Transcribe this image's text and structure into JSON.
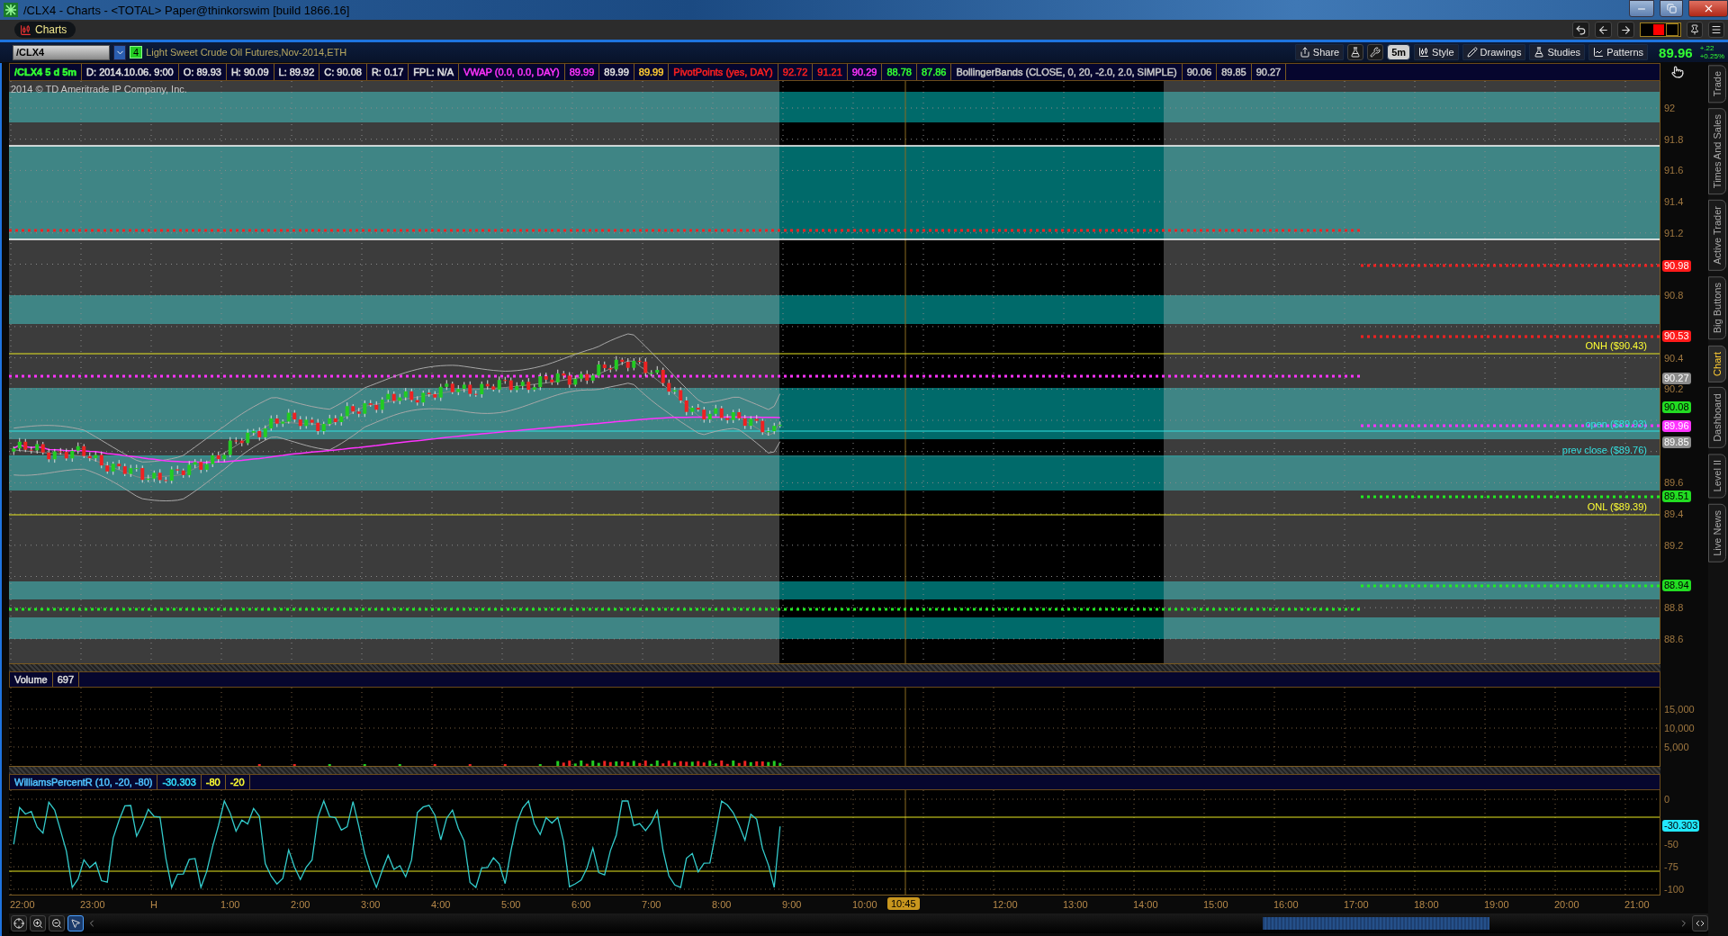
{
  "window": {
    "title": "/CLX4 - Charts - <TOTAL> Paper@thinkorswim [build 1866.16]"
  },
  "app_bar": {
    "tab": "Charts"
  },
  "symbol_bar": {
    "symbol": "/CLX4",
    "badge": "4",
    "description": "Light Sweet Crude Oil Futures,Nov-2014,ETH",
    "tools": [
      {
        "kind": "button",
        "label": "Share"
      },
      {
        "kind": "icon"
      },
      {
        "kind": "icon"
      },
      {
        "kind": "interval",
        "label": "5m"
      },
      {
        "kind": "button",
        "label": "Style"
      },
      {
        "kind": "button",
        "label": "Drawings"
      },
      {
        "kind": "button",
        "label": "Studies"
      },
      {
        "kind": "button",
        "label": "Patterns"
      }
    ],
    "last": "89.96",
    "change": "+.22",
    "change_pct": "+0.25%"
  },
  "study_header": [
    {
      "text": "/CLX4 5 d 5m",
      "color": "#33ff33"
    },
    {
      "text": "D: 2014.10.06. 9:00",
      "color": "#e0e0e0"
    },
    {
      "text": "O: 89.93",
      "color": "#e0e0e0"
    },
    {
      "text": "H: 90.09",
      "color": "#e0e0e0"
    },
    {
      "text": "L: 89.92",
      "color": "#e0e0e0"
    },
    {
      "text": "C: 90.08",
      "color": "#e0e0e0"
    },
    {
      "text": "R: 0.17",
      "color": "#e0e0e0"
    },
    {
      "text": "FPL: N/A",
      "color": "#e0e0e0"
    },
    {
      "text": "VWAP (0.0, 0.0, DAY)",
      "color": "#ff33ff"
    },
    {
      "text": "89.99",
      "color": "#ff33ff"
    },
    {
      "text": "89.99",
      "color": "#e0e0e0"
    },
    {
      "text": "89.99",
      "color": "#ffcc33"
    },
    {
      "text": "PivotPoints (yes, DAY)",
      "color": "#ff2020"
    },
    {
      "text": "92.72",
      "color": "#ff2020"
    },
    {
      "text": "91.21",
      "color": "#ff2020"
    },
    {
      "text": "90.29",
      "color": "#ff33ff"
    },
    {
      "text": "88.78",
      "color": "#33ff33"
    },
    {
      "text": "87.86",
      "color": "#33ff33"
    },
    {
      "text": "BollingerBands (CLOSE, 0, 20, -2.0, 2.0, SIMPLE)",
      "color": "#c8c8c8"
    },
    {
      "text": "90.06",
      "color": "#c8c8c8"
    },
    {
      "text": "89.85",
      "color": "#c8c8c8"
    },
    {
      "text": "90.27",
      "color": "#c8c8c8"
    }
  ],
  "price_chart": {
    "watermark": "2014 © TD Ameritrade IP Company, Inc.",
    "price_ticks": [
      "92",
      "91.8",
      "91.6",
      "91.4",
      "91.2",
      "90.8",
      "90.4",
      "90.2",
      "89.6",
      "89.4",
      "89.2",
      "88.8",
      "88.6"
    ],
    "level_tags": [
      {
        "text": "90.98",
        "color": "#ff1a1a"
      },
      {
        "text": "90.53",
        "color": "#ff1a1a"
      },
      {
        "text": "90.27",
        "color": "#8c8c8c"
      },
      {
        "text": "90.08",
        "color": "#22dd22"
      },
      {
        "text": "89.96",
        "color": "#ff33ff"
      },
      {
        "text": "89.85",
        "color": "#8c8c8c"
      },
      {
        "text": "89.51",
        "color": "#22dd22"
      },
      {
        "text": "88.94",
        "color": "#22dd22"
      }
    ],
    "line_labels": [
      {
        "text": "ONH ($90.43)",
        "color": "#ffff33"
      },
      {
        "text": "open ($89.93)",
        "color": "#33e0e0"
      },
      {
        "text": "prev close ($89.76)",
        "color": "#33e0e0"
      },
      {
        "text": "ONL ($89.39)",
        "color": "#ffff33"
      }
    ]
  },
  "volume": {
    "title": "Volume",
    "value": "697",
    "ticks": [
      "15,000",
      "10,000",
      "5,000"
    ]
  },
  "williams": {
    "cells": [
      {
        "text": "WilliamsPercentR (10, -20, -80)",
        "color": "#4fc3ff"
      },
      {
        "text": "-30.303",
        "color": "#33e0ff"
      },
      {
        "text": "-80",
        "color": "#ffff33"
      },
      {
        "text": "-20",
        "color": "#ffff33"
      }
    ],
    "ticks": [
      "0",
      "-50",
      "-75",
      "-100"
    ],
    "tag": "-30.303"
  },
  "time_axis": {
    "labels": [
      "22:00",
      "23:00",
      "H",
      "1:00",
      "2:00",
      "3:00",
      "4:00",
      "5:00",
      "6:00",
      "7:00",
      "8:00",
      "9:00",
      "10:00",
      "12:00",
      "13:00",
      "14:00",
      "15:00",
      "16:00",
      "17:00",
      "18:00",
      "19:00",
      "20:00",
      "21:00"
    ],
    "cursor": "10:45"
  },
  "bottom_tools": [
    {
      "selected": false
    },
    {
      "selected": false
    },
    {
      "selected": false
    },
    {
      "selected": true
    }
  ],
  "side_tabs": [
    {
      "label": "Trade",
      "selected": false
    },
    {
      "label": "Times And Sales",
      "selected": false
    },
    {
      "label": "Active Trader",
      "selected": false
    },
    {
      "label": "Big Buttons",
      "selected": false
    },
    {
      "label": "Chart",
      "selected": true
    },
    {
      "label": "Dashboard",
      "selected": false
    },
    {
      "label": "Level II",
      "selected": false
    },
    {
      "label": "Live News",
      "selected": false
    }
  ]
}
